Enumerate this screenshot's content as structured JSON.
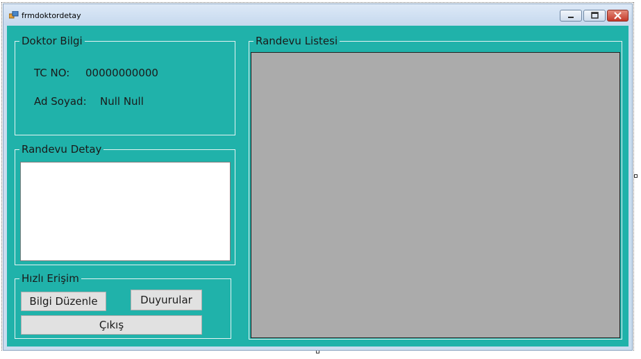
{
  "window": {
    "title": "frmdoktordetay",
    "icon": "form-icon",
    "controls": [
      "minimize-icon",
      "maximize-icon",
      "close-icon"
    ]
  },
  "doktor_bilgi": {
    "title": "Doktor Bilgi",
    "tc_label": "TC NO:",
    "tc_value": "00000000000",
    "name_label": "Ad Soyad:",
    "name_value": "Null Null"
  },
  "randevu_detay": {
    "title": "Randevu Detay",
    "text": ""
  },
  "hizli_erisim": {
    "title": "Hızlı Erişim",
    "bilgi_duzenle": "Bilgi Düzenle",
    "duyurular": "Duyurular",
    "cikis": "Çıkış"
  },
  "randevu_listesi": {
    "title": "Randevu Listesi"
  },
  "colors": {
    "form_back": "#20b2aa",
    "grid_back": "#ababab",
    "button_back": "#e1e1e1"
  }
}
